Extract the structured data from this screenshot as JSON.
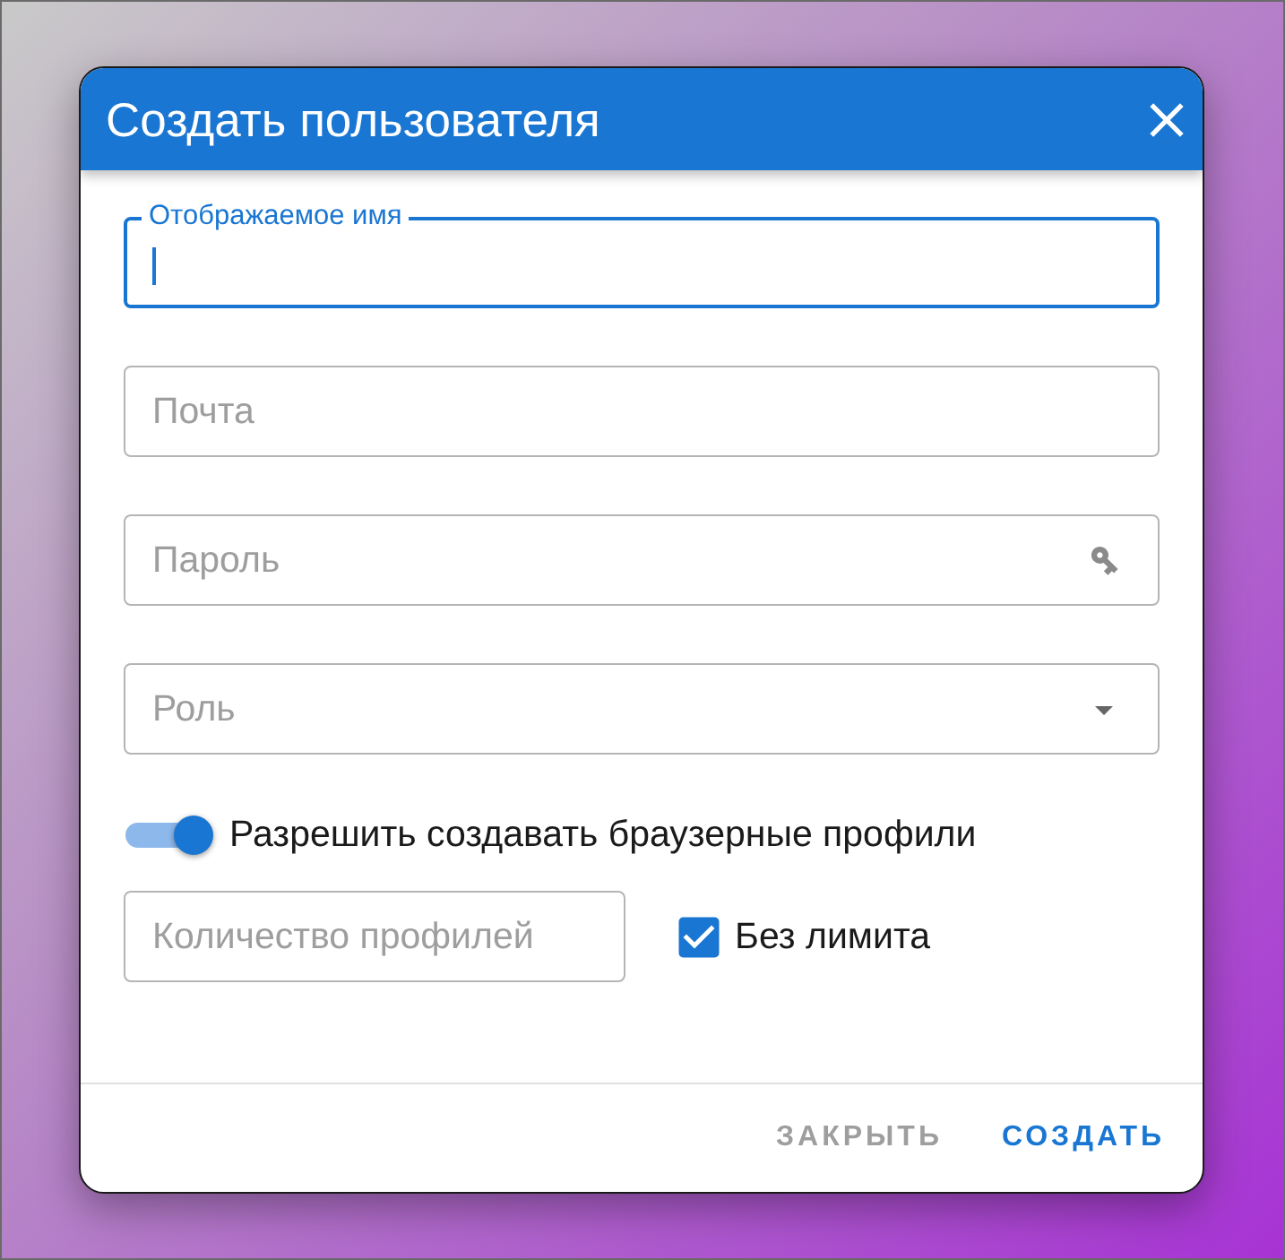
{
  "dialog": {
    "title": "Создать пользователя",
    "fields": [
      {
        "kind": "text",
        "label": "Отображаемое имя",
        "focused": true
      },
      {
        "kind": "text",
        "label": "Почта",
        "focused": false
      },
      {
        "kind": "password",
        "label": "Пароль",
        "focused": false
      },
      {
        "kind": "select",
        "label": "Роль",
        "focused": false
      }
    ],
    "profiles_switch": {
      "label": "Разрешить создавать браузерные профили",
      "on": true
    },
    "profile_count": {
      "label": "Количество профилей"
    },
    "no_limit": {
      "label": "Без лимита",
      "checked": true
    },
    "buttons": [
      {
        "kind": "secondary",
        "label": "ЗАКРЫТЬ"
      },
      {
        "kind": "primary",
        "label": "СОЗДАТЬ"
      }
    ]
  }
}
